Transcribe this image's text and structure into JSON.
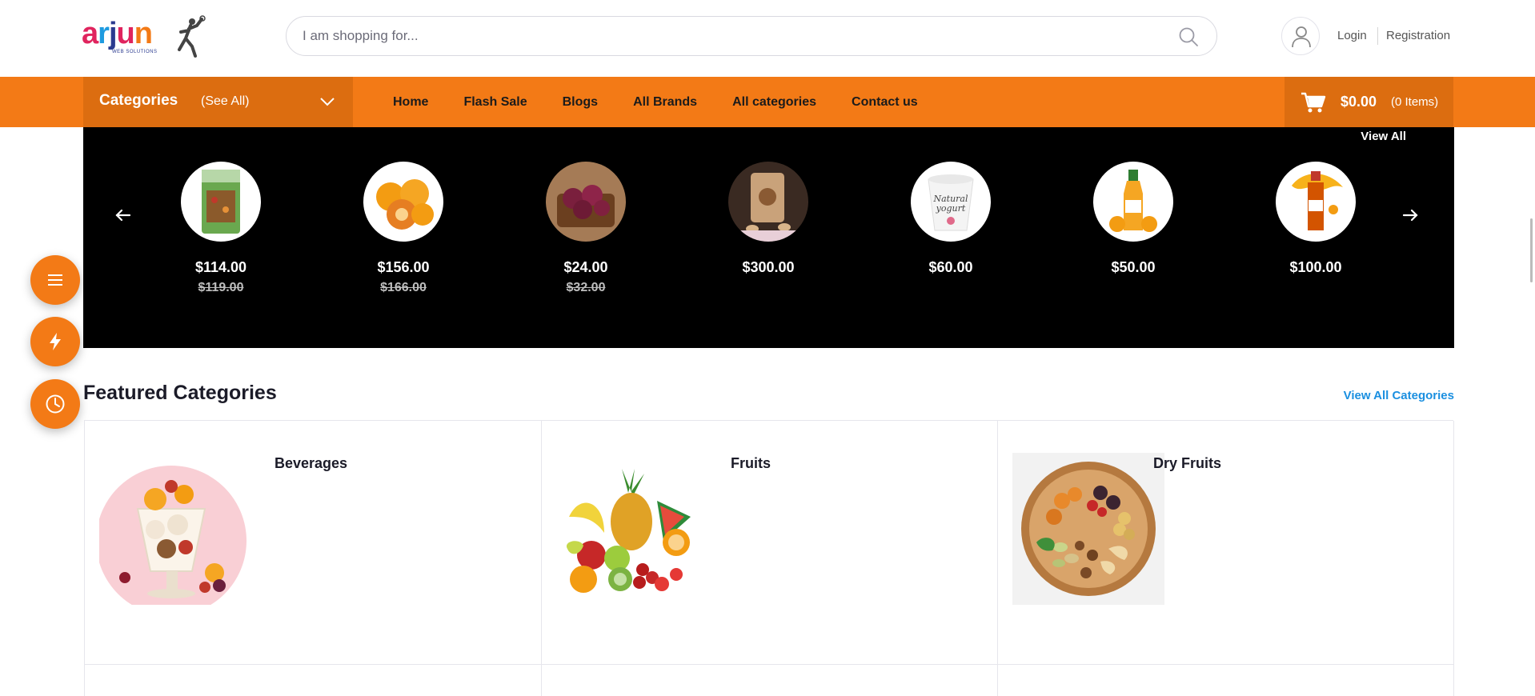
{
  "header": {
    "logo_text": "arjun",
    "logo_subtext": "WEB SOLUTIONS",
    "search_placeholder": "I am shopping for...",
    "login_label": "Login",
    "registration_label": "Registration"
  },
  "nav": {
    "categories_label": "Categories",
    "see_all_label": "(See All)",
    "links": [
      "Home",
      "Flash Sale",
      "Blogs",
      "All Brands",
      "All categories",
      "Contact us"
    ],
    "cart_amount": "$0.00",
    "cart_items": "(0 Items)"
  },
  "slider": {
    "view_all_label": "View All",
    "products": [
      {
        "price": "$114.00",
        "old_price": "$119.00",
        "icon": "snack-pack"
      },
      {
        "price": "$156.00",
        "old_price": "$166.00",
        "icon": "oranges"
      },
      {
        "price": "$24.00",
        "old_price": "$32.00",
        "icon": "red-onions"
      },
      {
        "price": "$300.00",
        "old_price": "",
        "icon": "nut-pouch"
      },
      {
        "price": "$60.00",
        "old_price": "",
        "icon": "natural-yogurt"
      },
      {
        "price": "$50.00",
        "old_price": "",
        "icon": "orange-juice-bottle"
      },
      {
        "price": "$100.00",
        "old_price": "",
        "icon": "mango-drink-bottle"
      }
    ]
  },
  "featured": {
    "title": "Featured Categories",
    "view_all_label": "View All Categories",
    "categories": [
      {
        "name": "Beverages",
        "icon": "fruit-dessert"
      },
      {
        "name": "Fruits",
        "icon": "fruit-bundle"
      },
      {
        "name": "Dry Fruits",
        "icon": "dry-fruit-bowl"
      }
    ]
  },
  "colors": {
    "accent": "#f37a16",
    "accent_dark": "#dc6d10",
    "slider_bg": "#000000",
    "link_blue": "#1a8fe0"
  }
}
